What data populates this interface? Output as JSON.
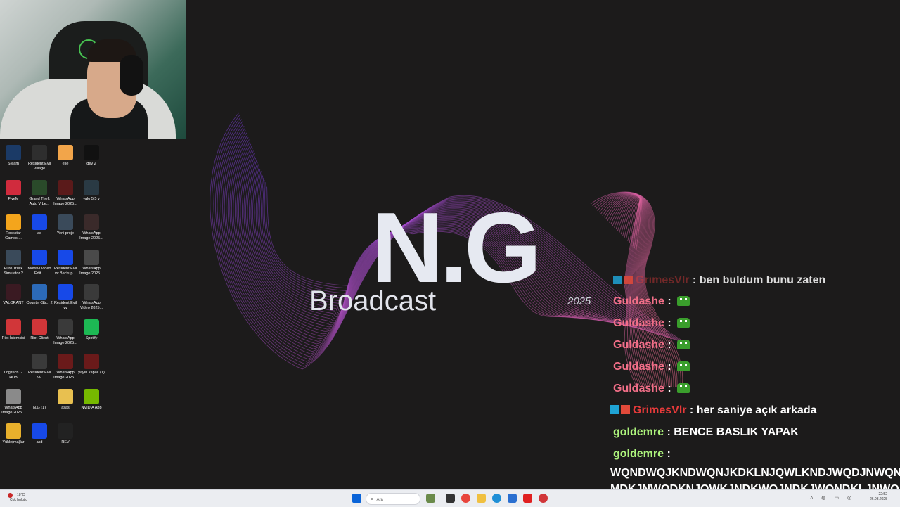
{
  "overlay": {
    "title": "N.G",
    "subtitle": "Broadcast",
    "year": "2025"
  },
  "desktop_icons": [
    {
      "label": "Steam",
      "icon": "steam-icon",
      "color": "#1b3a66"
    },
    {
      "label": "Resident Evil Village",
      "icon": "re-village-icon",
      "color": "#2e2e2e"
    },
    {
      "label": "ese",
      "icon": "image-file-icon",
      "color": "#f2a54a"
    },
    {
      "label": "dev 2",
      "icon": "video-file-icon",
      "color": "#111111"
    },
    {
      "label": "FiveM",
      "icon": "fivem-icon",
      "color": "#d02b3d"
    },
    {
      "label": "Grand Theft Auto V Le...",
      "icon": "gta-icon",
      "color": "#2a4a2a"
    },
    {
      "label": "WhatsApp Image 2025...",
      "icon": "image-file-icon",
      "color": "#5a1a1a"
    },
    {
      "label": "valo 5 5 v",
      "icon": "video-file-icon",
      "color": "#2a3a44"
    },
    {
      "label": "Rockstar Games ...",
      "icon": "rockstar-icon",
      "color": "#f4a51c"
    },
    {
      "label": "as",
      "icon": "app-icon",
      "color": "#1749e8"
    },
    {
      "label": "Yeni proje",
      "icon": "project-file-icon",
      "color": "#3a4a5a"
    },
    {
      "label": "WhatsApp Image 2025...",
      "icon": "image-file-icon",
      "color": "#3a2a2a"
    },
    {
      "label": "Euro Truck Simulator 2",
      "icon": "ets2-icon",
      "color": "#3a4a5a"
    },
    {
      "label": "Movavi Video Edit...",
      "icon": "app-icon",
      "color": "#1749e8"
    },
    {
      "label": "Resident Evil vv Backup...",
      "icon": "app-icon",
      "color": "#1749e8"
    },
    {
      "label": "WhatsApp Image 2025...",
      "icon": "image-file-icon",
      "color": "#4a4a4a"
    },
    {
      "label": "VALORANT",
      "icon": "valorant-icon",
      "color": "#3a1a22"
    },
    {
      "label": "Counter-Str... 2",
      "icon": "cs2-icon",
      "color": "#2c6ab8"
    },
    {
      "label": "Resident Evil vv",
      "icon": "app-icon",
      "color": "#1749e8"
    },
    {
      "label": "WhatsApp Video 2025...",
      "icon": "video-file-icon",
      "color": "#3a3a3a"
    },
    {
      "label": "Riot İstemcisi",
      "icon": "riot-icon",
      "color": "#d13639"
    },
    {
      "label": "Riot Client",
      "icon": "riot-icon",
      "color": "#d13639"
    },
    {
      "label": "WhatsApp Image 2025...",
      "icon": "image-file-icon",
      "color": "#3a3a3a"
    },
    {
      "label": "Spotify",
      "icon": "spotify-icon",
      "color": "#1db954"
    },
    {
      "label": "Logitech G HUB",
      "icon": "logitech-icon",
      "color": "#1c1b1b"
    },
    {
      "label": "Resident Evil vv",
      "icon": "video-file-icon",
      "color": "#3a3a3a"
    },
    {
      "label": "WhatsApp Image 2025...",
      "icon": "image-file-icon",
      "color": "#6a1a1a"
    },
    {
      "label": "yayın kapalı (1)",
      "icon": "image-file-icon",
      "color": "#6a1a1a"
    },
    {
      "label": "WhatsApp Image 2025...",
      "icon": "image-file-icon",
      "color": "#8a8a8a"
    },
    {
      "label": "N.G (1)",
      "icon": "image-file-icon",
      "color": "#1c1b1b"
    },
    {
      "label": "asas",
      "icon": "folder-icon",
      "color": "#e8c050"
    },
    {
      "label": "NVIDIA App",
      "icon": "nvidia-icon",
      "color": "#76b900"
    },
    {
      "label": "Yükle(ma)lar",
      "icon": "folder-icon",
      "color": "#e8b02c"
    },
    {
      "label": "asd",
      "icon": "app-icon",
      "color": "#1749e8"
    },
    {
      "label": "REV",
      "icon": "video-file-icon",
      "color": "#222222"
    }
  ],
  "chat": {
    "partial_line": "ben buldum bunu zaten",
    "lines": [
      {
        "user": "Guldashe",
        "sep": ":",
        "message": "",
        "emote": "frog-emote",
        "user_color": "pink"
      },
      {
        "user": "Guldashe",
        "sep": ":",
        "message": "",
        "emote": "frog-emote",
        "user_color": "pink"
      },
      {
        "user": "Guldashe",
        "sep": ":",
        "message": "",
        "emote": "frog-emote",
        "user_color": "pink"
      },
      {
        "user": "Guldashe",
        "sep": ":",
        "message": "",
        "emote": "frog-emote",
        "user_color": "pink"
      },
      {
        "user": "Guldashe",
        "sep": ":",
        "message": "",
        "emote": "frog-emote",
        "user_color": "pink"
      },
      {
        "user": "GrimesVlr",
        "sep": ":",
        "message": "her saniye açık arkada",
        "emote": "",
        "user_color": "red"
      },
      {
        "user": "goldemre",
        "sep": ":",
        "message": "BENCE BASLIK YAPAK",
        "emote": "",
        "user_color": "green"
      },
      {
        "user": "goldemre",
        "sep": ":",
        "message": "",
        "emote": "",
        "user_color": "green"
      }
    ],
    "spam_line_1": "WQNDWQJKNDWQNJKDKLNJQWLKNDJWQDJNWQN",
    "spam_line_2": "MDKJNWQDKNJQWKJNDKWQJNDKJWQNDKLJNWQ"
  },
  "taskbar": {
    "weather_temp": "18°C",
    "weather_desc": "Çok bulutlu",
    "search_placeholder": "Ara",
    "time": "22:52",
    "date": "26.03.2025",
    "colors": {
      "accent": "#0a64d8"
    }
  }
}
